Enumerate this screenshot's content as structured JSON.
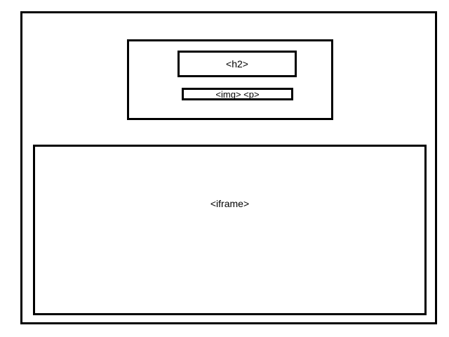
{
  "diagram": {
    "header_block": {
      "h2_label": "<h2>",
      "img_p_label": "<img> <p>"
    },
    "iframe_label": "<iframe>"
  }
}
